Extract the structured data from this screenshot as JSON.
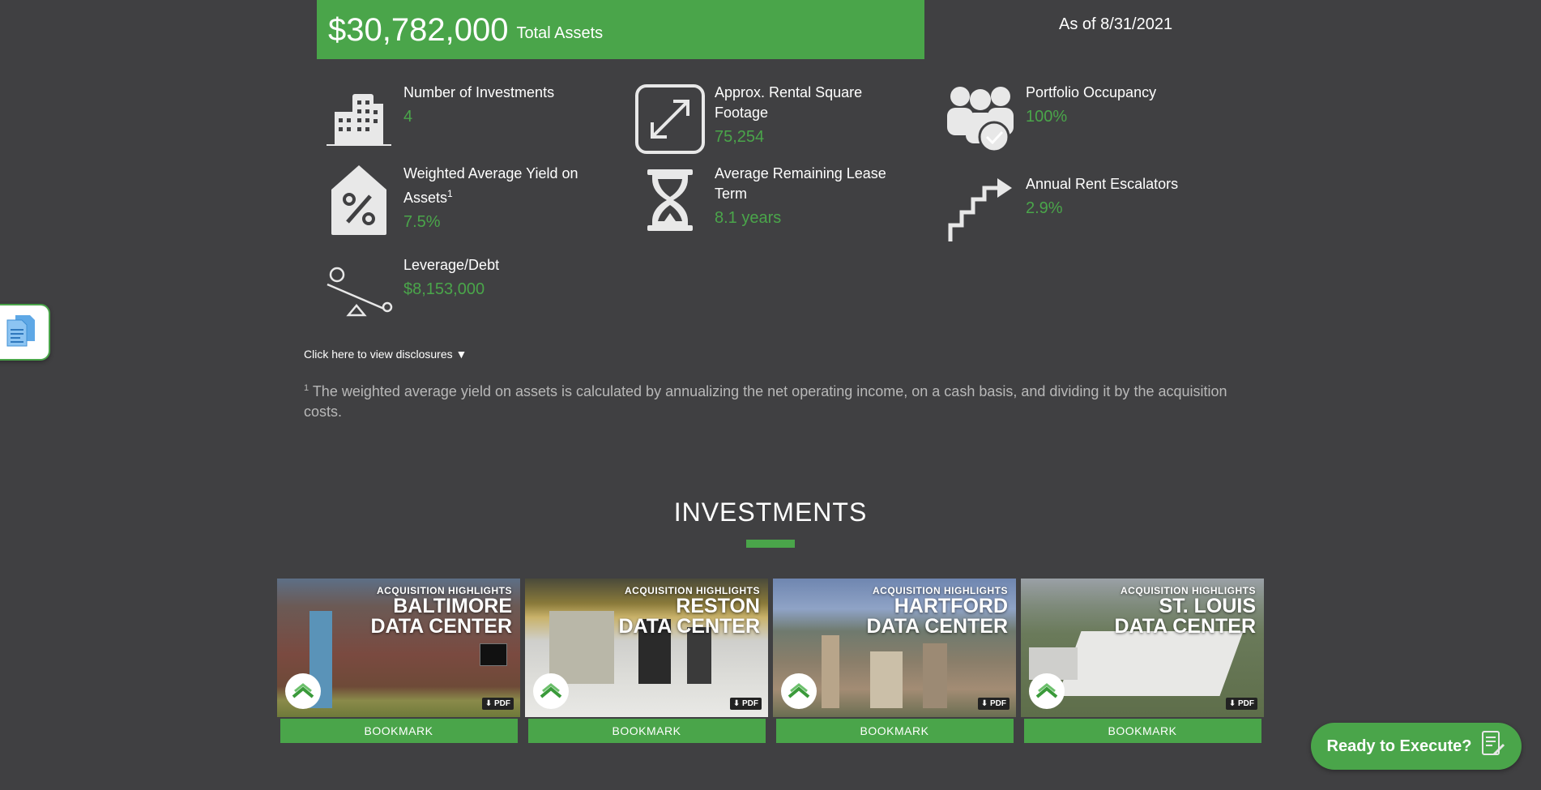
{
  "summary": {
    "total_amount": "$30,782,000",
    "total_label": "Total Assets",
    "as_of": "As of 8/31/2021"
  },
  "stats": [
    {
      "label": "Number of Investments",
      "value": "4",
      "icon": "buildings-icon"
    },
    {
      "label": "Approx. Rental Square Footage",
      "value": "75,254",
      "icon": "resize-arrows-icon"
    },
    {
      "label": "Portfolio Occupancy",
      "value": "100%",
      "icon": "people-check-icon"
    },
    {
      "label": "Weighted Average Yield on Assets",
      "label_sup": "1",
      "value": "7.5%",
      "icon": "house-percent-icon"
    },
    {
      "label": "Average Remaining Lease Term",
      "value": "8.1 years",
      "icon": "hourglass-icon"
    },
    {
      "label": "Annual Rent Escalators",
      "value": "2.9%",
      "icon": "stairs-arrow-icon"
    },
    {
      "label": "Leverage/Debt",
      "value": "$8,153,000",
      "icon": "seesaw-icon"
    }
  ],
  "disclosures": {
    "toggle_label": "Click here to view disclosures ▼",
    "footnote_marker": "1",
    "footnote_text": "The weighted average yield on assets is calculated by annualizing the net operating income, on a cash basis, and dividing it by the acquisition costs."
  },
  "investments": {
    "title": "INVESTMENTS",
    "cards": [
      {
        "kicker": "ACQUISITION HIGHLIGHTS",
        "city": "BALTIMORE",
        "line2": "DATA CENTER",
        "pdf": "PDF",
        "button": "BOOKMARK"
      },
      {
        "kicker": "ACQUISITION HIGHLIGHTS",
        "city": "RESTON",
        "line2": "DATA CENTER",
        "pdf": "PDF",
        "button": "BOOKMARK"
      },
      {
        "kicker": "ACQUISITION HIGHLIGHTS",
        "city": "HARTFORD",
        "line2": "DATA CENTER",
        "pdf": "PDF",
        "button": "BOOKMARK"
      },
      {
        "kicker": "ACQUISITION HIGHLIGHTS",
        "city": "ST. LOUIS",
        "line2": "DATA CENTER",
        "pdf": "PDF",
        "button": "BOOKMARK"
      }
    ]
  },
  "cta": {
    "label": "Ready to Execute?",
    "icon": "document-sign-icon"
  },
  "side_tab": {
    "icon": "documents-icon"
  },
  "colors": {
    "background": "#404042",
    "accent": "#4aa54a",
    "muted_text": "#b8b8b8"
  }
}
